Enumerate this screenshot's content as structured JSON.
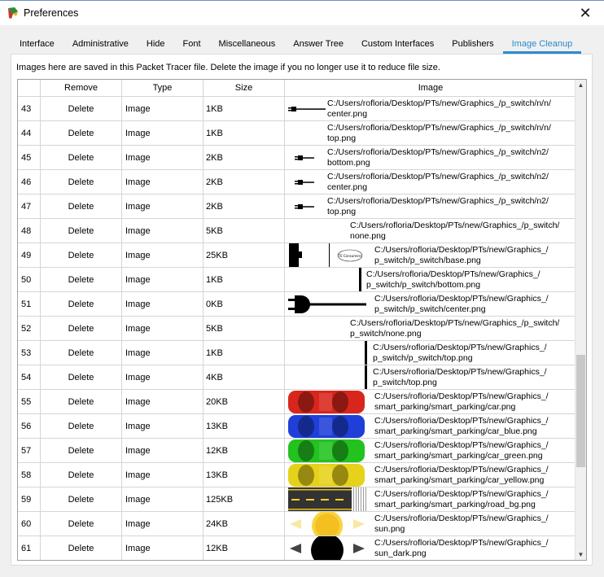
{
  "window": {
    "title": "Preferences",
    "close": "✕"
  },
  "tabs": [
    {
      "label": "Interface"
    },
    {
      "label": "Administrative"
    },
    {
      "label": "Hide"
    },
    {
      "label": "Font"
    },
    {
      "label": "Miscellaneous"
    },
    {
      "label": "Answer Tree"
    },
    {
      "label": "Custom Interfaces"
    },
    {
      "label": "Publishers"
    },
    {
      "label": "Image Cleanup",
      "active": true
    }
  ],
  "description": "Images here are saved in this Packet Tracer file. Delete the image if you no longer use it to reduce file size.",
  "columns": {
    "remove": "Remove",
    "type": "Type",
    "size": "Size",
    "image": "Image"
  },
  "rows": [
    {
      "num": "43",
      "action": "Delete",
      "type": "Image",
      "size": "1KB",
      "path1": "C:/Users/rofloria/Desktop/PTs/new/Graphics_/p_switch/n/n/",
      "path2": "center.png",
      "thumb": "line-plug"
    },
    {
      "num": "44",
      "action": "Delete",
      "type": "Image",
      "size": "1KB",
      "path1": "C:/Users/rofloria/Desktop/PTs/new/Graphics_/p_switch/n/n/",
      "path2": "top.png",
      "thumb": "none"
    },
    {
      "num": "45",
      "action": "Delete",
      "type": "Image",
      "size": "2KB",
      "path1": "C:/Users/rofloria/Desktop/PTs/new/Graphics_/p_switch/n2/",
      "path2": "bottom.png",
      "thumb": "small-plug"
    },
    {
      "num": "46",
      "action": "Delete",
      "type": "Image",
      "size": "2KB",
      "path1": "C:/Users/rofloria/Desktop/PTs/new/Graphics_/p_switch/n2/",
      "path2": "center.png",
      "thumb": "small-plug"
    },
    {
      "num": "47",
      "action": "Delete",
      "type": "Image",
      "size": "2KB",
      "path1": "C:/Users/rofloria/Desktop/PTs/new/Graphics_/p_switch/n2/",
      "path2": "top.png",
      "thumb": "small-plug"
    },
    {
      "num": "48",
      "action": "Delete",
      "type": "Image",
      "size": "5KB",
      "path1": "C:/Users/rofloria/Desktop/PTs/new/Graphics_/p_switch/",
      "path2": "none.png",
      "thumb": "blank-wide"
    },
    {
      "num": "49",
      "action": "Delete",
      "type": "Image",
      "size": "25KB",
      "path1": "C:/Users/rofloria/Desktop/PTs/new/Graphics_/",
      "path2": "p_switch/p_switch/base.png",
      "thumb": "base"
    },
    {
      "num": "50",
      "action": "Delete",
      "type": "Image",
      "size": "1KB",
      "path1": "C:/Users/rofloria/Desktop/PTs/new/Graphics_/",
      "path2": "p_switch/p_switch/bottom.png",
      "thumb": "vbar-92"
    },
    {
      "num": "51",
      "action": "Delete",
      "type": "Image",
      "size": "0KB",
      "path1": "C:/Users/rofloria/Desktop/PTs/new/Graphics_/",
      "path2": "p_switch/p_switch/center.png",
      "thumb": "big-plug"
    },
    {
      "num": "52",
      "action": "Delete",
      "type": "Image",
      "size": "5KB",
      "path1": "C:/Users/rofloria/Desktop/PTs/new/Graphics_/p_switch/",
      "path2": "p_switch/none.png",
      "thumb": "blank-wide"
    },
    {
      "num": "53",
      "action": "Delete",
      "type": "Image",
      "size": "1KB",
      "path1": "C:/Users/rofloria/Desktop/PTs/new/Graphics_/",
      "path2": "p_switch/p_switch/top.png",
      "thumb": "vbar-100"
    },
    {
      "num": "54",
      "action": "Delete",
      "type": "Image",
      "size": "4KB",
      "path1": "C:/Users/rofloria/Desktop/PTs/new/Graphics_/",
      "path2": "p_switch/top.png",
      "thumb": "vbar-100"
    },
    {
      "num": "55",
      "action": "Delete",
      "type": "Image",
      "size": "20KB",
      "path1": "C:/Users/rofloria/Desktop/PTs/new/Graphics_/",
      "path2": "smart_parking/smart_parking/car.png",
      "thumb": "car",
      "color": "#d8261c"
    },
    {
      "num": "56",
      "action": "Delete",
      "type": "Image",
      "size": "13KB",
      "path1": "C:/Users/rofloria/Desktop/PTs/new/Graphics_/",
      "path2": "smart_parking/smart_parking/car_blue.png",
      "thumb": "car",
      "color": "#1f3fd8"
    },
    {
      "num": "57",
      "action": "Delete",
      "type": "Image",
      "size": "12KB",
      "path1": "C:/Users/rofloria/Desktop/PTs/new/Graphics_/",
      "path2": "smart_parking/smart_parking/car_green.png",
      "thumb": "car",
      "color": "#22c21f"
    },
    {
      "num": "58",
      "action": "Delete",
      "type": "Image",
      "size": "13KB",
      "path1": "C:/Users/rofloria/Desktop/PTs/new/Graphics_/",
      "path2": "smart_parking/smart_parking/car_yellow.png",
      "thumb": "car",
      "color": "#e6d21a"
    },
    {
      "num": "59",
      "action": "Delete",
      "type": "Image",
      "size": "125KB",
      "path1": "C:/Users/rofloria/Desktop/PTs/new/Graphics_/",
      "path2": "smart_parking/smart_parking/road_bg.png",
      "thumb": "road"
    },
    {
      "num": "60",
      "action": "Delete",
      "type": "Image",
      "size": "24KB",
      "path1": "C:/Users/rofloria/Desktop/PTs/new/Graphics_/",
      "path2": "sun.png",
      "thumb": "sun"
    },
    {
      "num": "61",
      "action": "Delete",
      "type": "Image",
      "size": "12KB",
      "path1": "C:/Users/rofloria/Desktop/PTs/new/Graphics_/",
      "path2": "sun_dark.png",
      "thumb": "sun-dark"
    }
  ],
  "scrollbar": {
    "up": "▲",
    "down": "▼"
  }
}
